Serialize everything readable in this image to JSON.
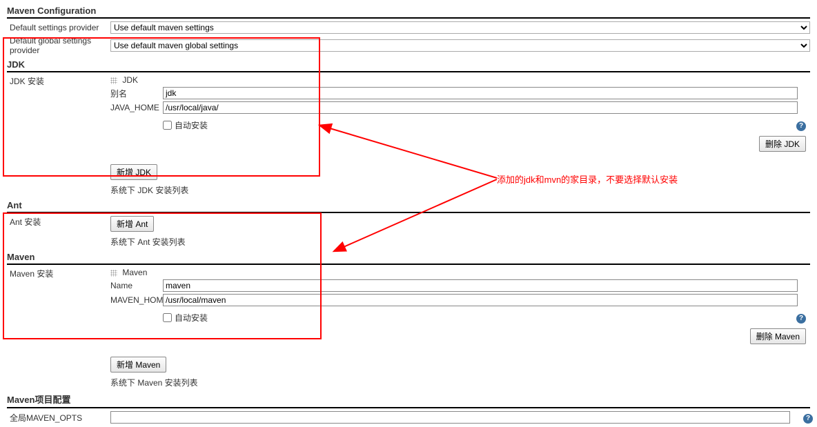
{
  "maven_config": {
    "title": "Maven Configuration",
    "default_settings_label": "Default settings provider",
    "default_settings_value": "Use default maven settings",
    "default_global_label": "Default global settings provider",
    "default_global_value": "Use default maven global settings"
  },
  "jdk": {
    "title": "JDK",
    "install_label": "JDK 安装",
    "sub_title": "JDK",
    "alias_label": "别名",
    "alias_value": "jdk",
    "javahome_label": "JAVA_HOME",
    "javahome_value": "/usr/local/java/",
    "auto_install": "自动安装",
    "delete_btn": "删除 JDK",
    "add_btn": "新增 JDK",
    "list_desc": "系统下 JDK 安装列表"
  },
  "ant": {
    "title": "Ant",
    "install_label": "Ant 安装",
    "add_btn": "新增 Ant",
    "list_desc": "系统下 Ant 安装列表"
  },
  "maven": {
    "title": "Maven",
    "install_label": "Maven 安装",
    "sub_title": "Maven",
    "name_label": "Name",
    "name_value": "maven",
    "home_label": "MAVEN_HOME",
    "home_value": "/usr/local/maven",
    "auto_install": "自动安装",
    "delete_btn": "删除 Maven",
    "add_btn": "新增 Maven",
    "list_desc": "系统下 Maven 安装列表"
  },
  "maven_project": {
    "title": "Maven项目配置",
    "opts_label": "全局MAVEN_OPTS"
  },
  "annotation": "添加的jdk和mvn的家目录，不要选择默认安装",
  "help_icon": "?"
}
